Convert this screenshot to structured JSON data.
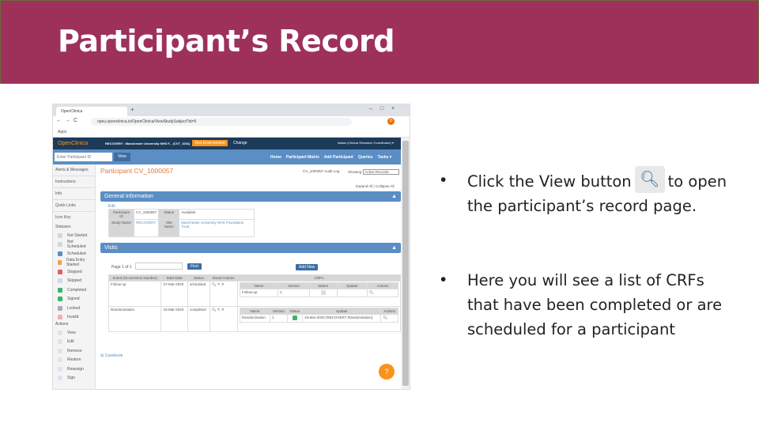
{
  "slide": {
    "title": "Participant’s Record",
    "bullets": [
      {
        "pre": "Click the View button",
        "post": "to open the participant’s record page."
      },
      {
        "text": "Here you will see a list of CRFs that have been completed or are scheduled for a participant"
      }
    ],
    "bullet_char": "•",
    "accent": "#9e3159"
  },
  "browser": {
    "tab": "OpenClinica",
    "url": "npeu.openclinica.io/OpenClinica/ViewStudySubject?id=5",
    "apps": "Apps",
    "avatar": "D"
  },
  "oc": {
    "logo": "OpenClinica",
    "study": "RECOVERY : Manchester University NHS F... (CVT_1001)",
    "env": "Test Environment",
    "change": "Change",
    "user": "datast (Clinical Research Coordinator) ▾",
    "search_placeholder": "Enter Participant ID",
    "view": "View",
    "nav": [
      "Home",
      "Participant Matrix",
      "Add Participant",
      "Queries",
      "Tasks ▾"
    ]
  },
  "sidebar": {
    "items": [
      "Alerts & Messages",
      "Instructions",
      "Info",
      "Quick Links",
      "Icon Key"
    ],
    "statuses_label": "Statuses",
    "statuses": [
      {
        "label": "Not Started",
        "color": "#cfd8e3"
      },
      {
        "label": "Not Scheduled",
        "color": "#cfd8e3"
      },
      {
        "label": "Scheduled",
        "color": "#5b8ec4"
      },
      {
        "label": "Data Entry Started",
        "color": "#f0a050"
      },
      {
        "label": "Stopped",
        "color": "#e06060"
      },
      {
        "label": "Skipped",
        "color": "#cfd8e3"
      },
      {
        "label": "Completed",
        "color": "#3cb371"
      },
      {
        "label": "Signed",
        "color": "#3cb371"
      },
      {
        "label": "Locked",
        "color": "#aab"
      },
      {
        "label": "Invalid",
        "color": "#f0b0b0"
      }
    ],
    "actions_label": "Actions",
    "actions": [
      "View",
      "Edit",
      "Remove",
      "Restore",
      "Reassign",
      "Sign"
    ]
  },
  "main": {
    "title": "Participant CV_1000057",
    "audit": "CV_1000057 Audit Log",
    "showing": "Showing",
    "showing_value": "Active Records",
    "expand": "Expand All",
    "collapse": "Collapse All",
    "general": "General Information",
    "edit": "Edit",
    "pid_label": "Participant ID",
    "pid": "CV_1000057",
    "status_label": "Status",
    "status": "Available",
    "study_label": "Study Name",
    "study": "RECOVERY",
    "site_label": "Site Name",
    "site": "Manchester University NHS Foundation Trust",
    "visits": "Visits",
    "page": "Page 1 of 1",
    "find": "Find",
    "add_new": "Add New",
    "cols": [
      "Event (Occurrence Number)",
      "Start Date",
      "Status",
      "Event Actions",
      "CRFs"
    ],
    "crf_cols": [
      "Name",
      "Version",
      "Status",
      "Update",
      "Actions"
    ],
    "events": [
      {
        "name": "Follow-up",
        "date": "27-Mar-2020",
        "status": "scheduled",
        "crf": {
          "name": "Follow-up",
          "version": "1",
          "update": ""
        }
      },
      {
        "name": "Randomisation",
        "date": "19-Mar-2020",
        "status": "completed",
        "crf": {
          "name": "Randomisation",
          "version": "1",
          "update": "19-Mar-2020 (RECOVERY Randomisation)"
        }
      }
    ],
    "casebook": "Casebook",
    "help": "?"
  }
}
